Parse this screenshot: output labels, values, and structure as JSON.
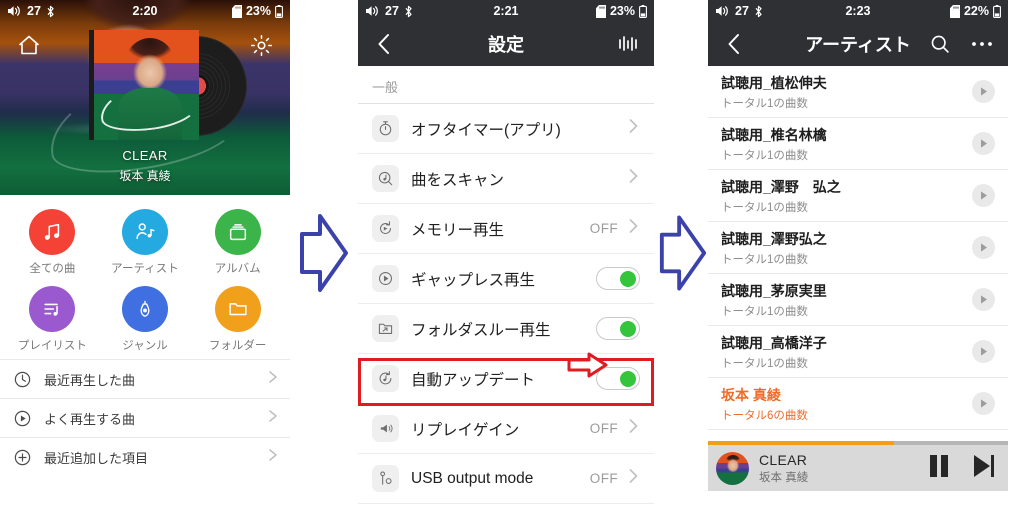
{
  "panels": {
    "home": {
      "status": {
        "volume": "27",
        "time": "2:20",
        "battery": "23%"
      },
      "now_playing": {
        "title": "CLEAR",
        "artist": "坂本 真綾"
      },
      "top_icons": {
        "home": "home-icon",
        "settings": "gear-icon"
      },
      "grid": [
        {
          "label": "全ての曲",
          "icon": "music-note-icon",
          "color": "#f44336"
        },
        {
          "label": "アーティスト",
          "icon": "artist-icon",
          "color": "#24aae1"
        },
        {
          "label": "アルバム",
          "icon": "album-icon",
          "color": "#3bb54a"
        },
        {
          "label": "プレイリスト",
          "icon": "playlist-icon",
          "color": "#9b59d0"
        },
        {
          "label": "ジャンル",
          "icon": "guitar-icon",
          "color": "#3f6fe0"
        },
        {
          "label": "フォルダー",
          "icon": "folder-icon",
          "color": "#f0a01b"
        }
      ],
      "quick_lists": [
        {
          "label": "最近再生した曲",
          "icon": "clock-icon"
        },
        {
          "label": "よく再生する曲",
          "icon": "play-circle-icon"
        },
        {
          "label": "最近追加した項目",
          "icon": "plus-circle-icon"
        }
      ]
    },
    "settings": {
      "status": {
        "volume": "27",
        "time": "2:21",
        "battery": "23%"
      },
      "nav": {
        "title": "設定",
        "back": "back-chevron-icon",
        "right": "equalizer-icon"
      },
      "section_title": "一般",
      "rows": [
        {
          "label": "オフタイマー(アプリ)",
          "icon": "timer-icon",
          "control": "chevron",
          "value": ""
        },
        {
          "label": "曲をスキャン",
          "icon": "scan-icon",
          "control": "chevron",
          "value": ""
        },
        {
          "label": "メモリー再生",
          "icon": "memory-icon",
          "control": "chevron",
          "value": "OFF"
        },
        {
          "label": "ギャップレス再生",
          "icon": "gapless-icon",
          "control": "toggle",
          "value": "ON"
        },
        {
          "label": "フォルダスルー再生",
          "icon": "folder-thru-icon",
          "control": "toggle",
          "value": "ON"
        },
        {
          "label": "自動アップデート",
          "icon": "auto-update-icon",
          "control": "toggle",
          "value": "ON",
          "highlighted": true
        },
        {
          "label": "リプレイゲイン",
          "icon": "replaygain-icon",
          "control": "chevron",
          "value": "OFF"
        },
        {
          "label": "USB output mode",
          "icon": "usb-icon",
          "control": "chevron",
          "value": "OFF"
        }
      ],
      "annotation": {
        "box_color": "#e11b22",
        "arrow": "red-right-arrow-icon"
      }
    },
    "artists": {
      "status": {
        "volume": "27",
        "time": "2:23",
        "battery": "22%"
      },
      "nav": {
        "title": "アーティスト",
        "back": "back-chevron-icon",
        "search": "search-icon",
        "more": "more-icon"
      },
      "rows": [
        {
          "name": "試聴用_植松伸夫",
          "sub": "トータル1の曲数",
          "current": false
        },
        {
          "name": "試聴用_椎名林檎",
          "sub": "トータル1の曲数",
          "current": false
        },
        {
          "name": "試聴用_澤野　弘之",
          "sub": "トータル1の曲数",
          "current": false
        },
        {
          "name": "試聴用_澤野弘之",
          "sub": "トータル1の曲数",
          "current": false
        },
        {
          "name": "試聴用_茅原実里",
          "sub": "トータル1の曲数",
          "current": false
        },
        {
          "name": "試聴用_高橋洋子",
          "sub": "トータル1の曲数",
          "current": false
        },
        {
          "name": "坂本 真綾",
          "sub": "トータル6の曲数",
          "current": true
        }
      ],
      "miniplayer": {
        "title": "CLEAR",
        "artist": "坂本 真綾",
        "progress_percent": 62,
        "progress_color": "#f0a017",
        "pause": "pause-icon",
        "next": "next-track-icon"
      }
    }
  },
  "flow": {
    "arrow_color": "#3b43ab",
    "arrow_1": "flow-arrow-right",
    "arrow_2": "flow-arrow-right"
  }
}
